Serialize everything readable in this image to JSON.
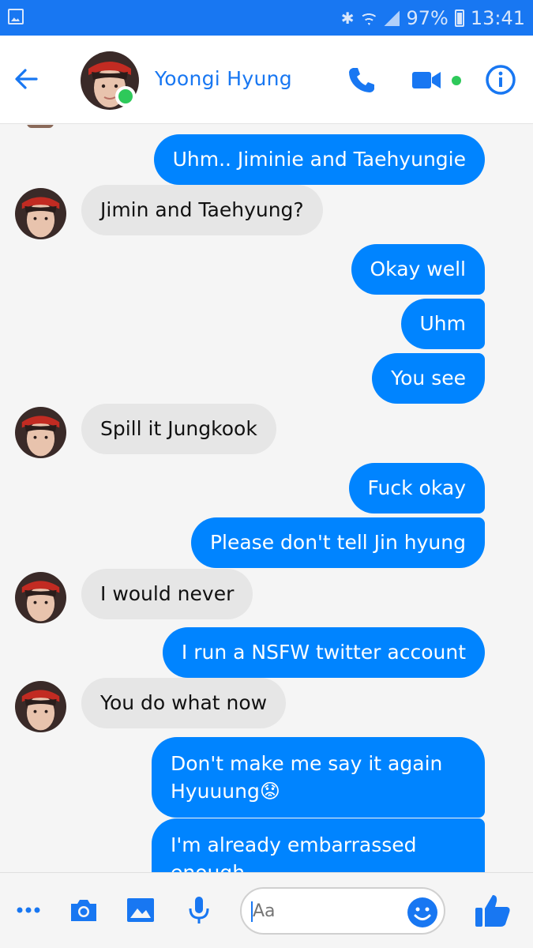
{
  "status_bar": {
    "battery": "97%",
    "time": "13:41",
    "icons": [
      "gallery-icon",
      "bluetooth-icon",
      "wifi-icon",
      "signal-icon",
      "battery-charging-icon"
    ]
  },
  "header": {
    "contact_name": "Yoongi Hyung",
    "online": true,
    "icons": [
      "back-arrow-icon",
      "phone-icon",
      "video-camera-icon",
      "info-icon"
    ],
    "accent_color": "#1877f2",
    "presence_color": "#2ec95a"
  },
  "messages": [
    {
      "from": "me",
      "text": "Uhm.. Jiminie and Taehyungie"
    },
    {
      "from": "them",
      "text": "Jimin and Taehyung?"
    },
    {
      "from": "me",
      "text": "Okay well"
    },
    {
      "from": "me",
      "text": "Uhm"
    },
    {
      "from": "me",
      "text": "You see"
    },
    {
      "from": "them",
      "text": "Spill it Jungkook"
    },
    {
      "from": "me",
      "text": "Fuck okay"
    },
    {
      "from": "me",
      "text": "Please don't tell Jin hyung"
    },
    {
      "from": "them",
      "text": "I would never"
    },
    {
      "from": "me",
      "text": "I run a NSFW twitter account"
    },
    {
      "from": "them",
      "text": "You do what now"
    },
    {
      "from": "me",
      "text": "Don't make me say it again Hyuuung😟"
    },
    {
      "from": "me",
      "text": "I'm already embarrassed enough"
    }
  ],
  "colors": {
    "outgoing_bubble": "#0084ff",
    "incoming_bubble": "#e6e6e6",
    "background": "#f5f5f5"
  },
  "composer": {
    "placeholder": "Aa",
    "icons": [
      "more-icon",
      "camera-icon",
      "gallery-icon",
      "microphone-icon",
      "emoji-icon",
      "thumbs-up-icon"
    ]
  }
}
